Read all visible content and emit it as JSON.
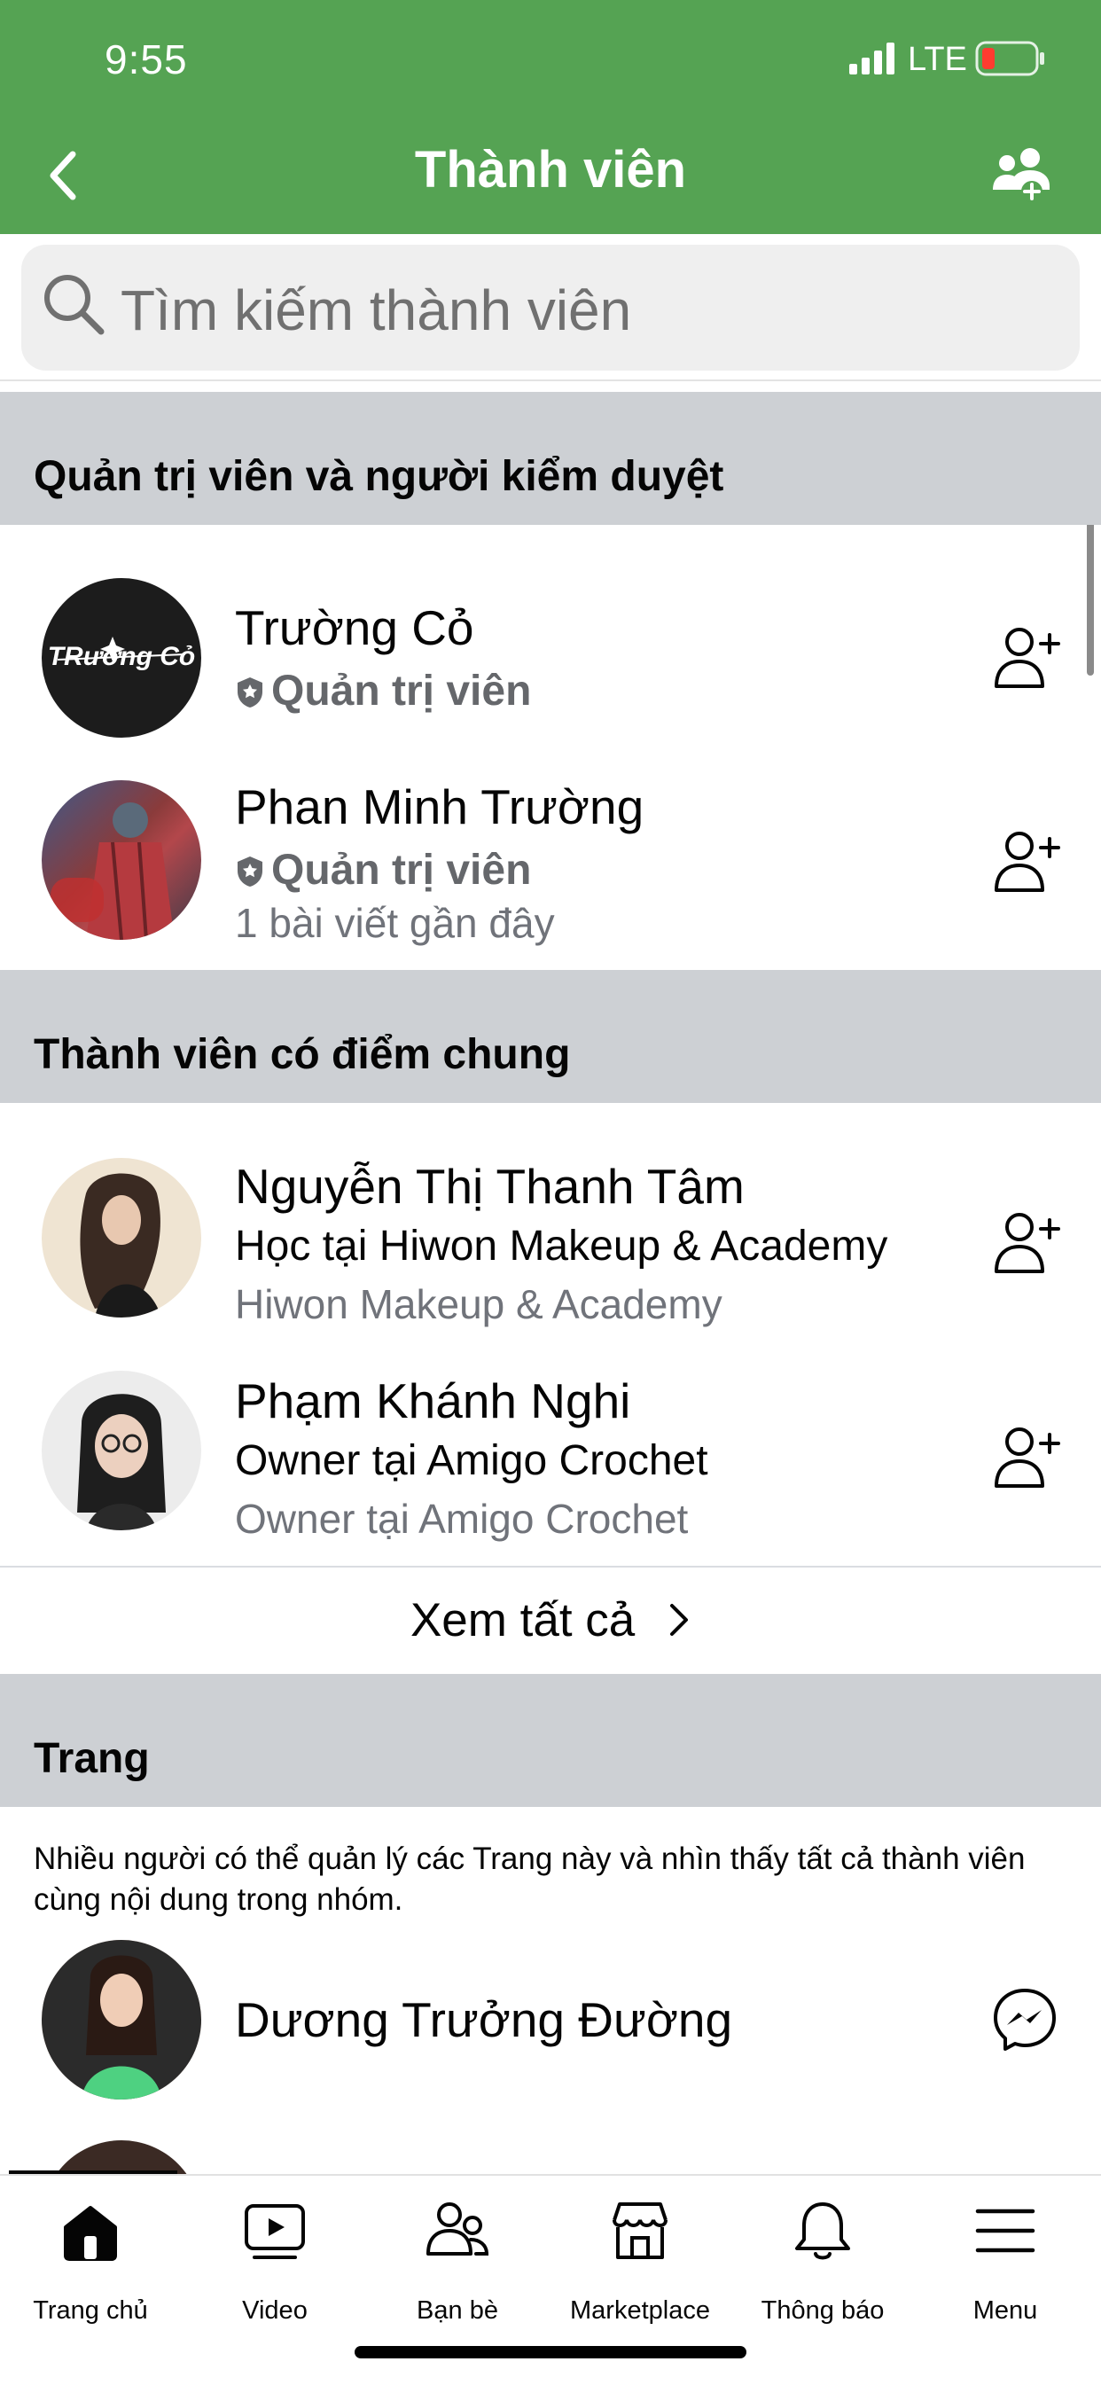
{
  "status_bar": {
    "time": "9:55",
    "network": "LTE"
  },
  "header": {
    "title": "Thành viên",
    "back_icon": "chevron-left-icon",
    "action_icon": "group-add-icon"
  },
  "search": {
    "placeholder": "Tìm kiếm thành viên"
  },
  "sections": {
    "admins": {
      "title": "Quản trị viên và người kiểm duyệt",
      "members": [
        {
          "name": "Trường Cỏ",
          "role": "Quản trị viên",
          "detail": "",
          "avatar_text": "Trường Cỏ"
        },
        {
          "name": "Phan Minh Trường",
          "role": "Quản trị viên",
          "detail": "1 bài viết gần đây"
        }
      ]
    },
    "common": {
      "title": "Thành viên có điểm chung",
      "members": [
        {
          "name": "Nguyễn Thị Thanh Tâm",
          "sub": "Học tại Hiwon Makeup & Academy",
          "detail": "Hiwon Makeup & Academy"
        },
        {
          "name": "Phạm Khánh Nghi",
          "sub": "Owner tại Amigo Crochet",
          "detail": "Owner tại Amigo Crochet"
        }
      ],
      "see_all": "Xem tất cả"
    },
    "pages": {
      "title": "Trang",
      "note": "Nhiều người có thể quản lý các Trang này và nhìn thấy tất cả thành viên cùng nội dung trong nhóm.",
      "members": [
        {
          "name": "Dương Trưởng Đường"
        }
      ]
    }
  },
  "tabs": [
    {
      "label": "Trang chủ",
      "icon": "home-icon"
    },
    {
      "label": "Video",
      "icon": "video-icon"
    },
    {
      "label": "Bạn bè",
      "icon": "friends-icon"
    },
    {
      "label": "Marketplace",
      "icon": "marketplace-icon"
    },
    {
      "label": "Thông báo",
      "icon": "bell-icon"
    },
    {
      "label": "Menu",
      "icon": "menu-icon"
    }
  ],
  "colors": {
    "header": "#55a353",
    "section": "#cdd0d4",
    "search_bg": "#efefef"
  }
}
